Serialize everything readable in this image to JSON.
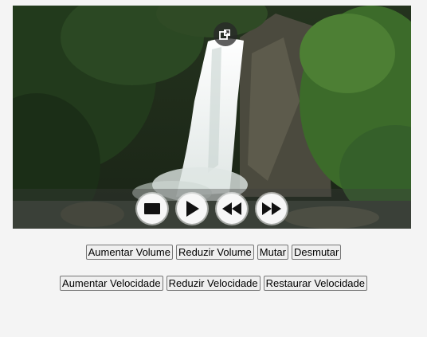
{
  "video": {
    "scene_icon": "waterfall-forest-frame",
    "overlay_icons": [
      "picture-in-picture-icon",
      "stop-icon",
      "play-icon",
      "rewind-icon",
      "fast-forward-icon"
    ]
  },
  "volume_controls": {
    "increase_label": "Aumentar Volume",
    "decrease_label": "Reduzir Volume",
    "mute_label": "Mutar",
    "unmute_label": "Desmutar"
  },
  "speed_controls": {
    "increase_label": "Aumentar Velocidade",
    "decrease_label": "Reduzir Velocidade",
    "reset_label": "Restaurar Velocidade"
  },
  "colors": {
    "page_background": "#f4f4f4",
    "button_background": "#efefef",
    "button_border": "#767676"
  }
}
